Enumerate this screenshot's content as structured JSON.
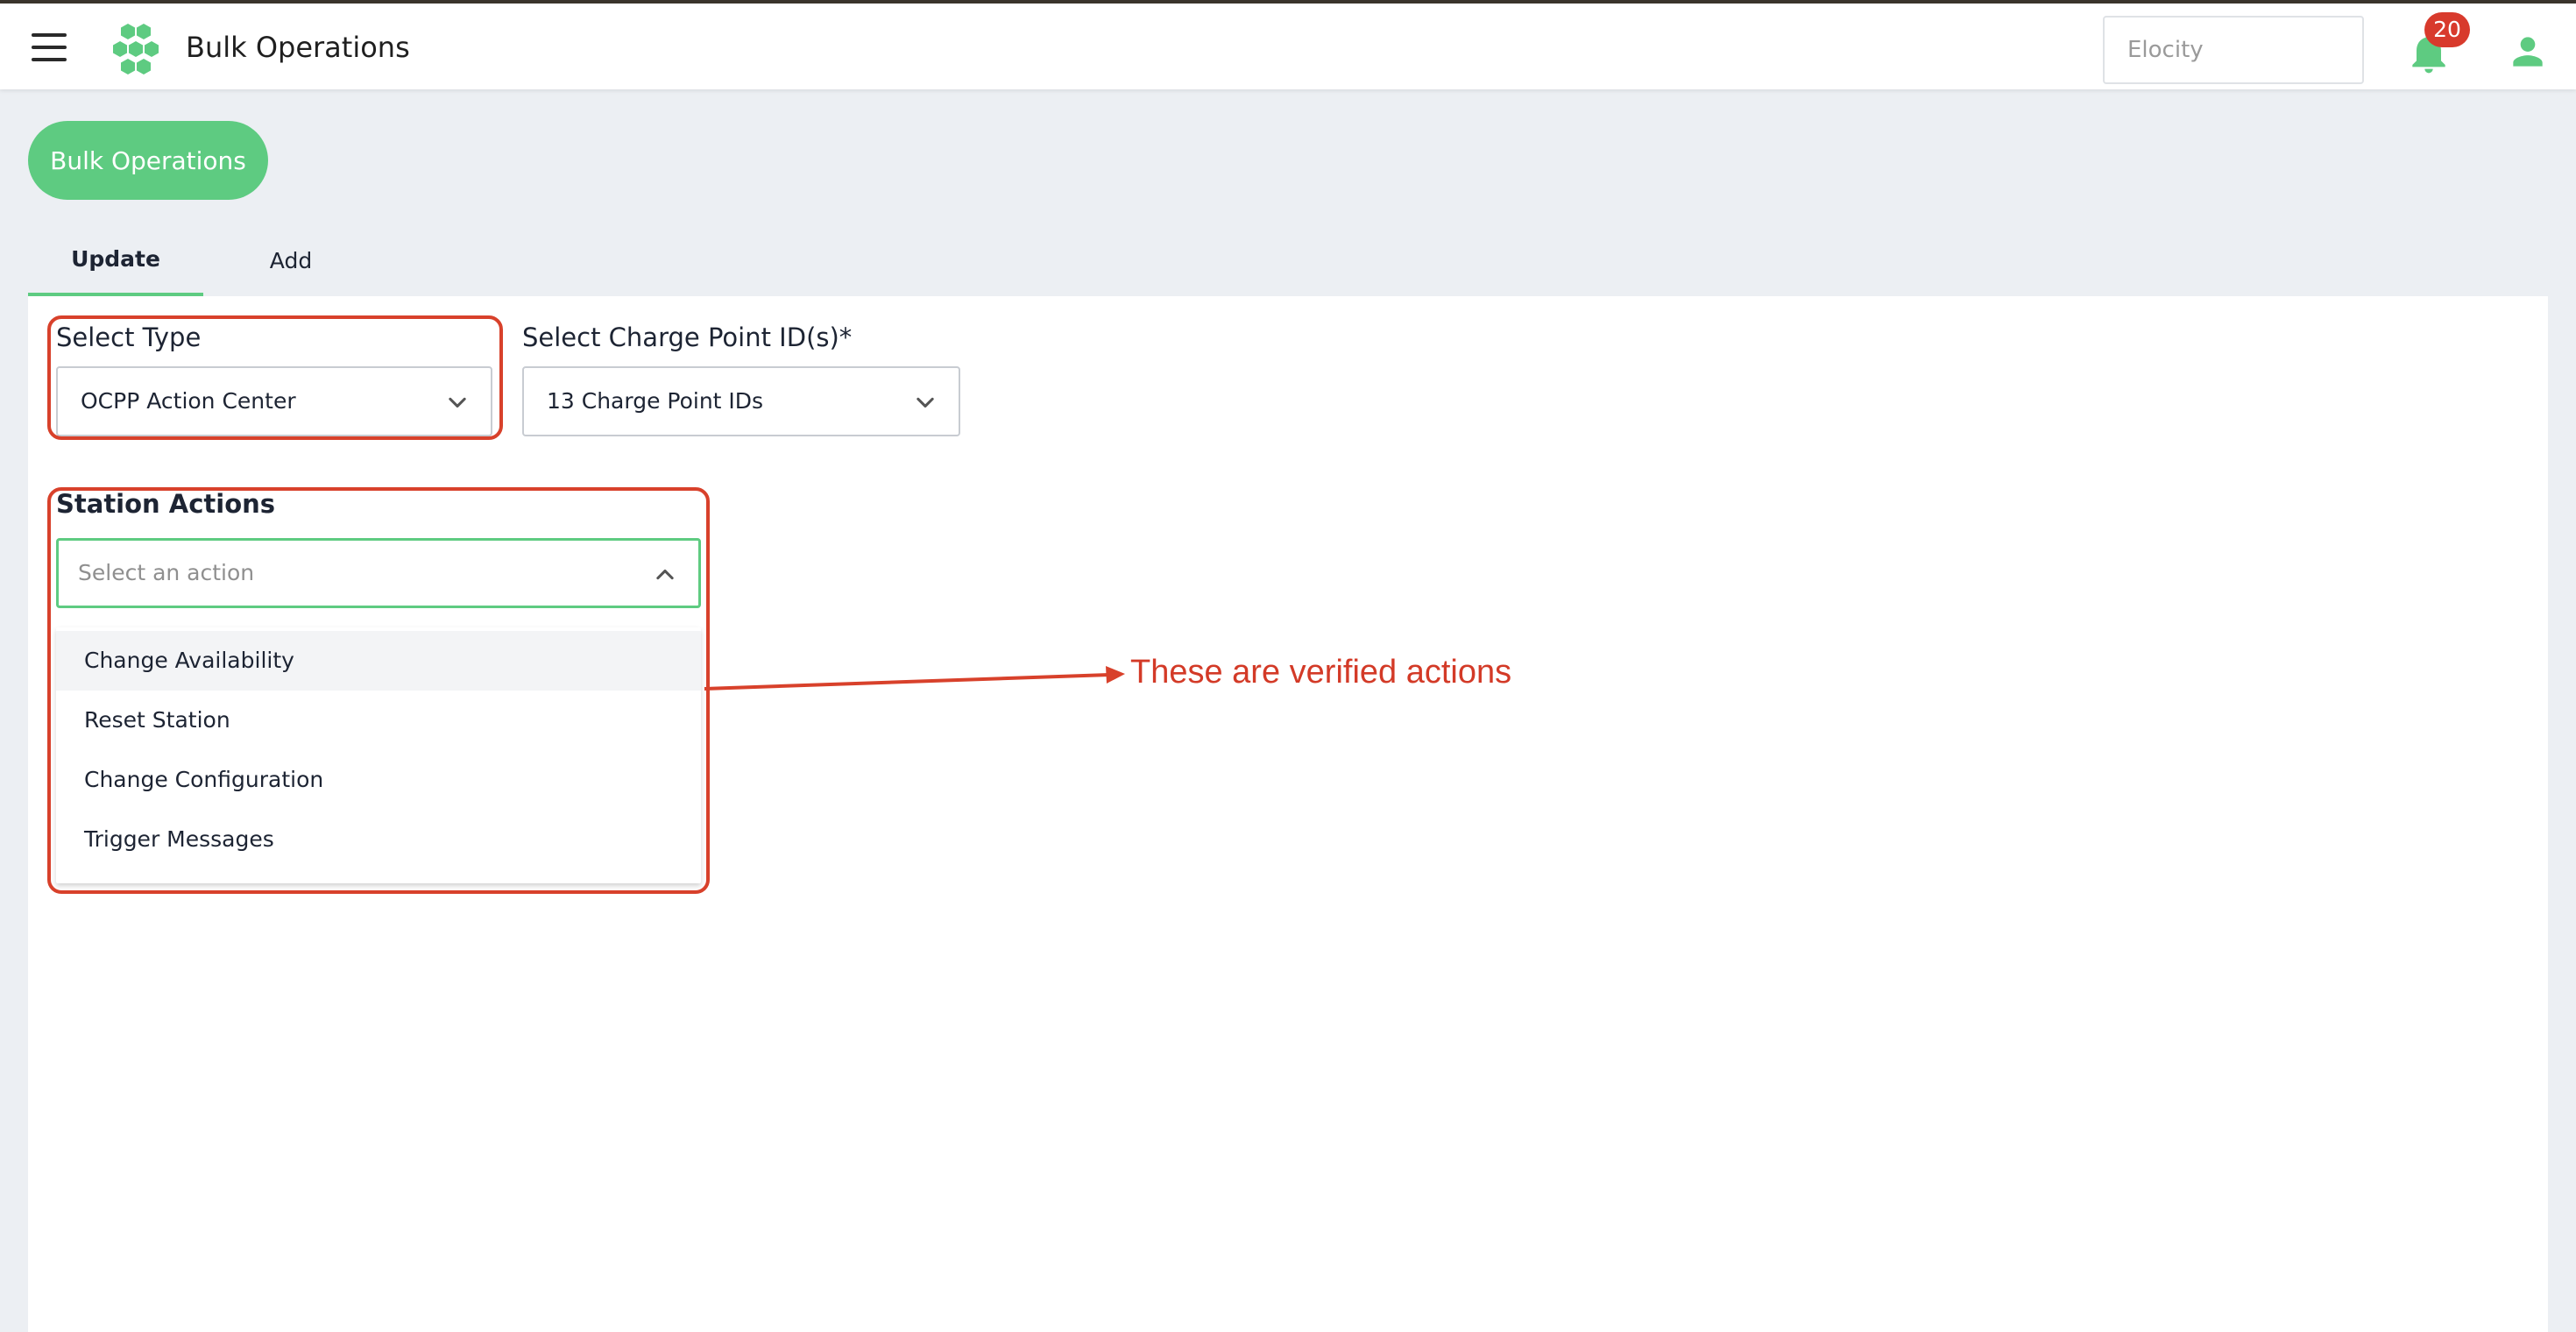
{
  "header": {
    "title": "Bulk Operations",
    "search_placeholder": "Elocity",
    "notifications_count": "20",
    "icons": [
      "menu-icon",
      "logo-hexagons",
      "bell-icon",
      "user-icon"
    ]
  },
  "page": {
    "header_button_label": "Bulk Operations"
  },
  "tabs": [
    {
      "label": "Update",
      "active": true
    },
    {
      "label": "Add",
      "active": false
    }
  ],
  "form": {
    "select_type": {
      "label": "Select Type",
      "value": "OCPP Action Center"
    },
    "charge_points": {
      "label": "Select Charge Point ID(s)*",
      "value": "13 Charge Point IDs"
    },
    "station_actions": {
      "label": "Station Actions",
      "placeholder": "Select an action",
      "options": [
        "Change Availability",
        "Reset Station",
        "Change Configuration",
        "Trigger Messages"
      ]
    }
  },
  "annotation": {
    "text": "These are verified actions",
    "color": "#d33a27"
  },
  "colors": {
    "accent": "#5ecb81",
    "badge": "#d83a2c",
    "annotation_outline": "#d8412b"
  }
}
